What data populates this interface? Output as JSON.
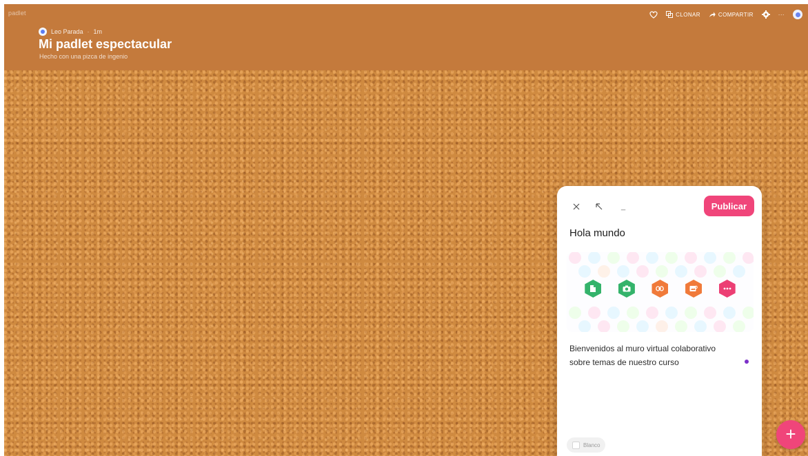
{
  "app": {
    "brand": "padlet"
  },
  "header": {
    "author": "Leo Parada",
    "separator": "·",
    "time_ago": "1m",
    "title": "Mi padlet espectacular",
    "subtitle": "Hecho con una pizca de ingenio"
  },
  "toolbar": {
    "clone_label": "CLONAR",
    "share_label": "COMPARTIR",
    "more_label": "···"
  },
  "composer": {
    "publish_label": "Publicar",
    "minimize_label": "_",
    "post_title": "Hola mundo",
    "attachment_icons": [
      "upload-icon",
      "camera-icon",
      "link-icon",
      "image-search-icon",
      "more-icon"
    ],
    "body_line1": "Bienvenidos al muro virtual colaborativo",
    "body_line2": "sobre temas de nuestro curso",
    "color_label": "Blanco"
  },
  "fab": {
    "label": "+"
  },
  "colors": {
    "header_bg": "#c47a3c",
    "cork_bg": "#cf8a40",
    "accent_pink": "#f0457a",
    "icon_green": "#34b36b",
    "icon_orange": "#f07a3a",
    "icon_magenta": "#ec3f74"
  }
}
